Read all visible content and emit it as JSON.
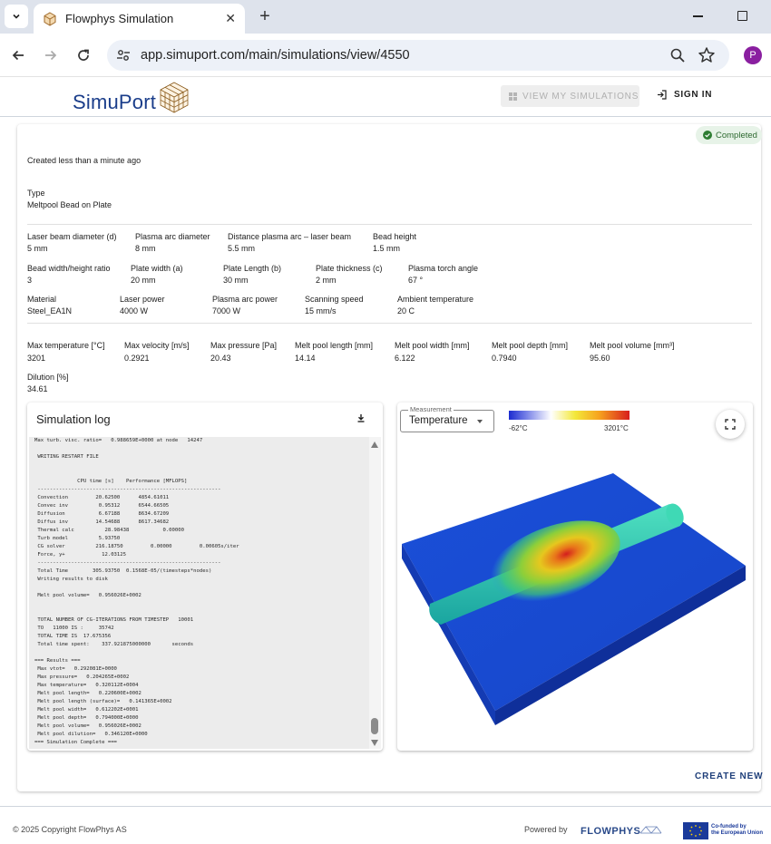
{
  "browser": {
    "tab_title": "Flowphys Simulation",
    "url": "app.simuport.com/main/simulations/view/4550",
    "profile_initial": "P"
  },
  "header": {
    "logo_text": "SimuPort",
    "view_simulations_label": "VIEW MY SIMULATIONS",
    "sign_in_label": "SIGN IN"
  },
  "status": {
    "label": "Completed",
    "color": "#2e7d32"
  },
  "created": "Created less than a minute ago",
  "type": {
    "label": "Type",
    "value": "Meltpool Bead on Plate"
  },
  "params": {
    "laser_beam_diameter": {
      "label": "Laser beam diameter (d)",
      "value": "5 mm"
    },
    "plasma_arc_diameter": {
      "label": "Plasma arc diameter",
      "value": "8 mm"
    },
    "distance_plasma_laser": {
      "label": "Distance plasma arc – laser beam",
      "value": "5.5 mm"
    },
    "bead_height": {
      "label": "Bead height",
      "value": "1.5 mm"
    },
    "bead_ratio": {
      "label": "Bead width/height ratio",
      "value": "3"
    },
    "plate_width": {
      "label": "Plate width (a)",
      "value": "20 mm"
    },
    "plate_length": {
      "label": "Plate Length (b)",
      "value": "30 mm"
    },
    "plate_thickness": {
      "label": "Plate thickness (c)",
      "value": "2 mm"
    },
    "torch_angle": {
      "label": "Plasma torch angle",
      "value": "67 °"
    },
    "material": {
      "label": "Material",
      "value": "Steel_EA1N"
    },
    "laser_power": {
      "label": "Laser power",
      "value": "4000 W"
    },
    "plasma_power": {
      "label": "Plasma arc power",
      "value": "7000 W"
    },
    "scanning_speed": {
      "label": "Scanning speed",
      "value": "15 mm/s"
    },
    "ambient_temp": {
      "label": "Ambient temperature",
      "value": "20 C"
    }
  },
  "results": {
    "max_temperature": {
      "label": "Max temperature [°C]",
      "value": "3201"
    },
    "max_velocity": {
      "label": "Max velocity [m/s]",
      "value": "0.2921"
    },
    "max_pressure": {
      "label": "Max pressure [Pa]",
      "value": "20.43"
    },
    "melt_pool_length": {
      "label": "Melt pool length [mm]",
      "value": "14.14"
    },
    "melt_pool_width": {
      "label": "Melt pool width [mm]",
      "value": "6.122"
    },
    "melt_pool_depth": {
      "label": "Melt pool depth [mm]",
      "value": "0.7940"
    },
    "melt_pool_volume": {
      "label": "Melt pool volume [mm³]",
      "value": "95.60"
    },
    "dilution": {
      "label": "Dilution [%]",
      "value": "34.61"
    }
  },
  "log": {
    "title": "Simulation log",
    "content": "Max turb. visc. ratio=   0.988659E+0000 at node   14247\n\n WRITING RESTART FILE\n\n\n              CPU time [s]    Performance [MFLOPS]\n ------------------------------------------------------------\n Convection         20.62500      4854.61011\n Convec inv          0.95312      6544.66505\n Diffusion           6.67188      8634.67209\n Diffus inv         14.54688      8617.34682\n Thermal calc          28.98438           0.00000\n Turb model          5.93750\n CG solver          216.18750         0.00000         0.00605s/iter\n Force, y+            12.03125\n ------------------------------------------------------------\n Total Time        305.93750  0.1568E-05/(timesteps*nodes)\n Writing results to disk\n\n Melt pool volume=   0.956026E+0002\n\n\n TOTAL NUMBER OF CG-ITERATIONS FROM TIMESTEP   10001\n TO   11000 IS :     35742\n TOTAL TIME IS  17.675356\n Total time spent:    337.921875000000       seconds\n\n=== Results ===\n Max vtot=   0.292081E+0000\n Max pressure=   0.204265E+0002\n Max temperature=   0.320112E+0004\n Melt pool length=   0.220600E+0002\n Melt pool length (surface)=   0.141365E+0002\n Melt pool width=   0.612202E+0001\n Melt pool depth=   0.794000E+0000\n Melt pool volume=   0.956026E+0002\n Melt pool dilution=   0.346120E+0000\n=== Simulation Complete ==="
  },
  "viz": {
    "measurement_label": "Measurement",
    "measurement_value": "Temperature",
    "colorbar_min": "-62°C",
    "colorbar_max": "3201°C"
  },
  "create_new_label": "CREATE NEW",
  "footer": {
    "copyright": "© 2025 Copyright FlowPhys AS",
    "powered_by": "Powered by",
    "flowphys_logo": "FLOWPHYS",
    "eu_text_line1": "Co-funded by",
    "eu_text_line2": "the European Union"
  }
}
